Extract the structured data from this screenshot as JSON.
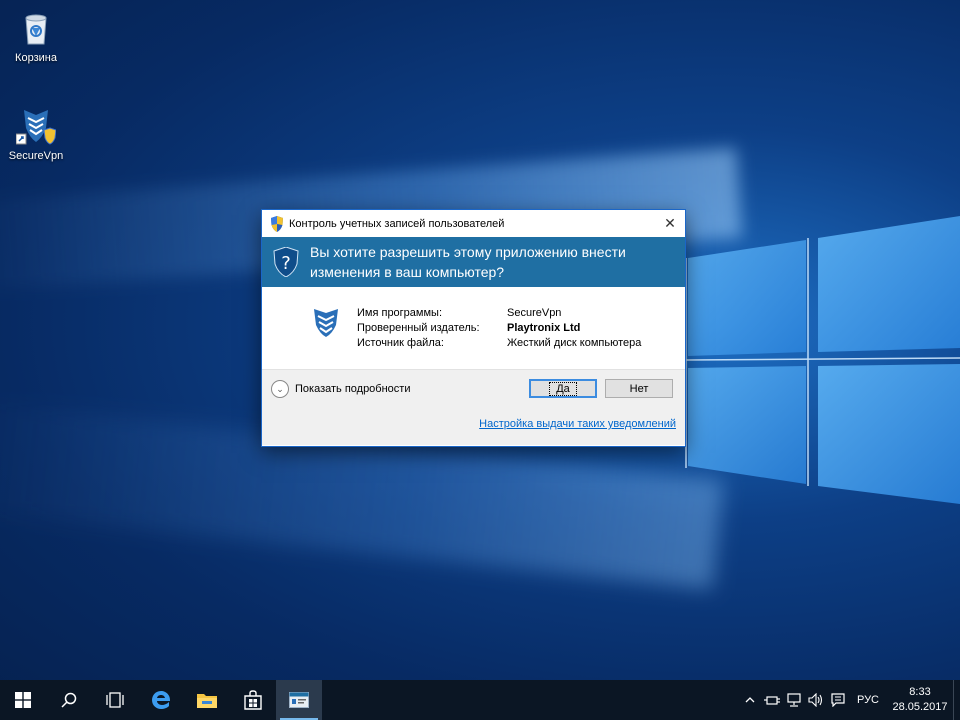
{
  "desktop": {
    "icons": [
      {
        "label": "Корзина",
        "icon": "recycle-bin-icon"
      },
      {
        "label": "SecureVpn",
        "icon": "securevpn-shortcut-icon"
      }
    ]
  },
  "uac_dialog": {
    "title": "Контроль учетных записей пользователей",
    "question": "Вы хотите разрешить этому приложению внести изменения в ваш компьютер?",
    "header_color": "#1f6fa3",
    "fields": [
      {
        "key": "Имя программы:",
        "value": "SecureVpn"
      },
      {
        "key": "Проверенный издатель:",
        "value": "Playtronix Ltd"
      },
      {
        "key": "Источник файла:",
        "value": "Жесткий диск компьютера"
      }
    ],
    "show_details_label": "Показать подробности",
    "yes_label": "Да",
    "no_label": "Нет",
    "settings_link": "Настройка выдачи таких уведомлений",
    "close_glyph": "✕"
  },
  "taskbar": {
    "items": [
      "start-icon",
      "search-icon",
      "task-view-icon",
      "edge-icon",
      "file-explorer-icon",
      "store-icon",
      "uac-window-icon"
    ],
    "tray": {
      "language": "РУС",
      "time": "8:33",
      "date": "28.05.2017"
    }
  }
}
